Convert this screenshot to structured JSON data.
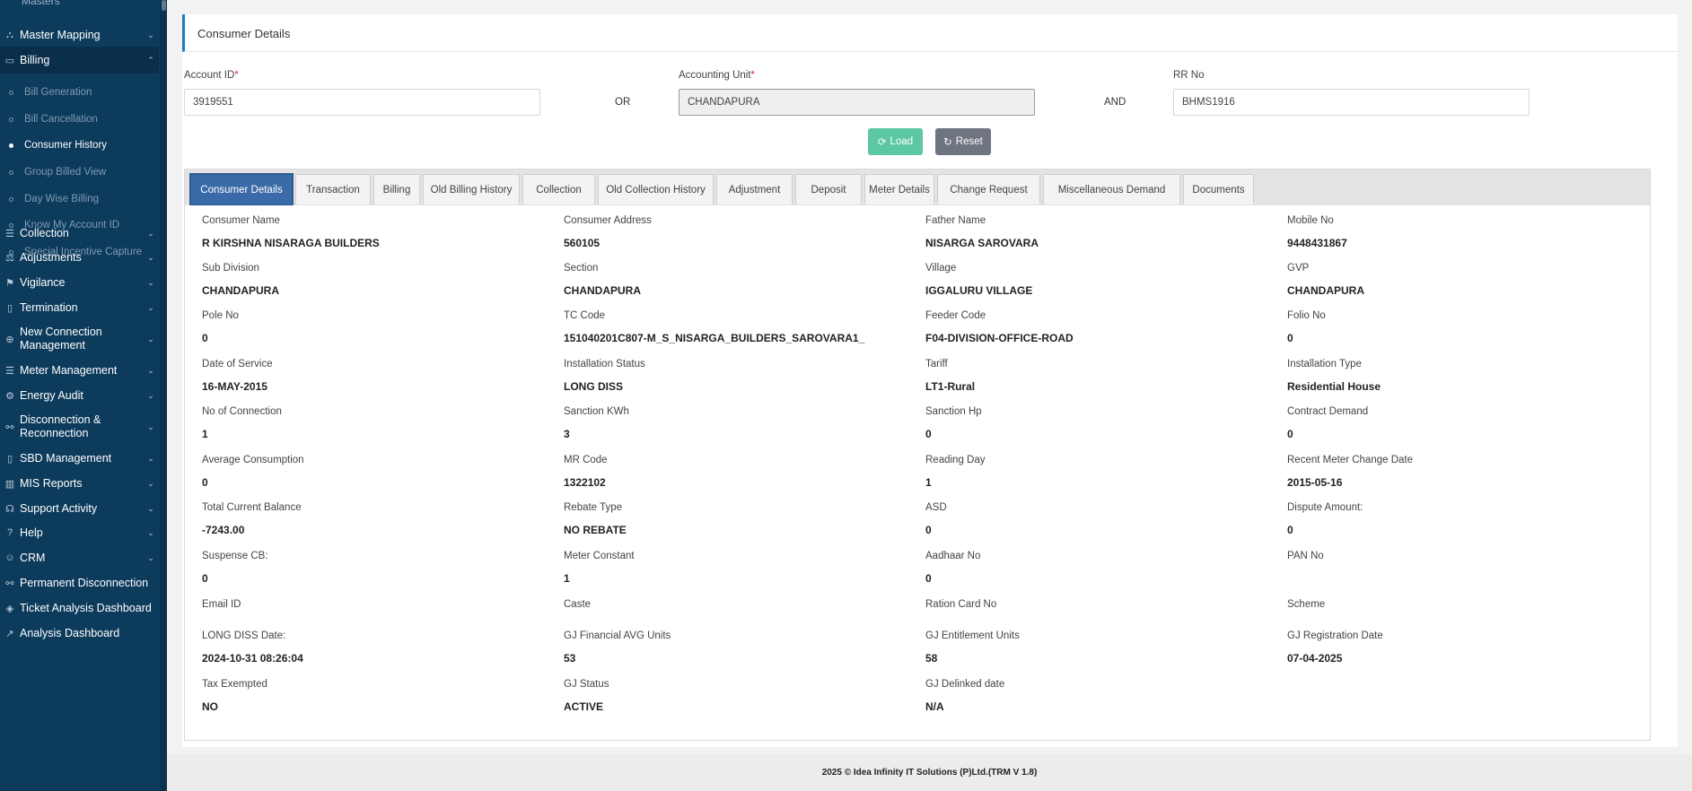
{
  "sidebar": {
    "cut_off_label": "Masters",
    "items": [
      {
        "label": "Master Mapping",
        "icon": "sitemap-icon",
        "glyph": "⛬",
        "chev": "⌄"
      },
      {
        "label": "Billing",
        "icon": "monitor-icon",
        "glyph": "▭",
        "chev": "⌃"
      },
      {
        "label": "Collection",
        "icon": "list-icon",
        "glyph": "☰",
        "chev": "⌄"
      },
      {
        "label": "Adjustments",
        "icon": "balance-icon",
        "glyph": "⚖",
        "chev": "⌄"
      },
      {
        "label": "Vigilance",
        "icon": "vigilance-icon",
        "glyph": "⚑",
        "chev": "⌄"
      },
      {
        "label": "Termination",
        "icon": "trash-icon",
        "glyph": "▯",
        "chev": "⌄"
      },
      {
        "label": "New Connection Management",
        "icon": "plus-circle-icon",
        "glyph": "⊕",
        "chev": "⌄"
      },
      {
        "label": "Meter Management",
        "icon": "list-icon",
        "glyph": "☰",
        "chev": "⌄"
      },
      {
        "label": "Energy Audit",
        "icon": "cogs-icon",
        "glyph": "⚙",
        "chev": "⌄"
      },
      {
        "label": "Disconnection & Reconnection",
        "icon": "link-icon",
        "glyph": "⚯",
        "chev": "⌄"
      },
      {
        "label": "SBD Management",
        "icon": "mobile-icon",
        "glyph": "▯",
        "chev": "⌄"
      },
      {
        "label": "MIS Reports",
        "icon": "bar-chart-icon",
        "glyph": "▥",
        "chev": "⌄"
      },
      {
        "label": "Support Activity",
        "icon": "headset-icon",
        "glyph": "☊",
        "chev": "⌄"
      },
      {
        "label": "Help",
        "icon": "question-icon",
        "glyph": "?",
        "chev": "⌄"
      },
      {
        "label": "CRM",
        "icon": "user-icon",
        "glyph": "☺",
        "chev": "⌄"
      },
      {
        "label": "Permanent Disconnection",
        "icon": "link-icon",
        "glyph": "⚯",
        "chev": ""
      },
      {
        "label": "Ticket Analysis Dashboard",
        "icon": "tag-icon",
        "glyph": "◈",
        "chev": ""
      },
      {
        "label": "Analysis Dashboard",
        "icon": "line-chart-icon",
        "glyph": "↗",
        "chev": ""
      }
    ],
    "billing_sub": [
      "Bill Generation",
      "Bill Cancellation",
      "Consumer History",
      "Group Billed View",
      "Day Wise Billing",
      "Know My Account ID",
      "Special Incentive Capture"
    ],
    "current_sub": "Consumer History"
  },
  "page": {
    "title": "Consumer Details"
  },
  "search": {
    "account_id_label": "Account ID",
    "account_id_value": "3919551",
    "or_label": "OR",
    "accounting_unit_label": "Accounting Unit",
    "accounting_unit_value": "CHANDAPURA",
    "and_label": "AND",
    "rr_no_label": "RR No",
    "rr_no_value": "BHMS1916",
    "required_mark": "*"
  },
  "buttons": {
    "load": "Load",
    "reset": "Reset"
  },
  "tabs": [
    "Consumer Details",
    "Transaction",
    "Billing",
    "Old Billing History",
    "Collection",
    "Old Collection History",
    "Adjustment",
    "Deposit",
    "Meter Details",
    "Change Request",
    "Miscellaneous Demand",
    "Documents"
  ],
  "active_tab": "Consumer Details",
  "details": [
    {
      "label": "Consumer Name",
      "value": "R KIRSHNA NISARAGA BUILDERS"
    },
    {
      "label": "Consumer Address",
      "value": "560105"
    },
    {
      "label": "Father Name",
      "value": "NISARGA SAROVARA"
    },
    {
      "label": "Mobile No",
      "value": "9448431867"
    },
    {
      "label": "Sub Division",
      "value": "CHANDAPURA"
    },
    {
      "label": "Section",
      "value": "CHANDAPURA"
    },
    {
      "label": "Village",
      "value": "IGGALURU VILLAGE"
    },
    {
      "label": "GVP",
      "value": "CHANDAPURA"
    },
    {
      "label": "Pole No",
      "value": "0"
    },
    {
      "label": "TC Code",
      "value": "151040201C807-M_S_NISARGA_BUILDERS_SAROVARA1_"
    },
    {
      "label": "Feeder Code",
      "value": "F04-DIVISION-OFFICE-ROAD"
    },
    {
      "label": "Folio No",
      "value": "0"
    },
    {
      "label": "Date of Service",
      "value": "16-MAY-2015"
    },
    {
      "label": "Installation Status",
      "value": "LONG DISS"
    },
    {
      "label": "Tariff",
      "value": "LT1-Rural"
    },
    {
      "label": "Installation Type",
      "value": "Residential House"
    },
    {
      "label": "No of Connection",
      "value": "1"
    },
    {
      "label": "Sanction KWh",
      "value": "3"
    },
    {
      "label": "Sanction Hp",
      "value": "0"
    },
    {
      "label": "Contract Demand",
      "value": "0"
    },
    {
      "label": "Average Consumption",
      "value": "0"
    },
    {
      "label": "MR Code",
      "value": "1322102"
    },
    {
      "label": "Reading Day",
      "value": "1"
    },
    {
      "label": "Recent Meter Change Date",
      "value": "2015-05-16"
    },
    {
      "label": "Total Current Balance",
      "value": "-7243.00"
    },
    {
      "label": "Rebate Type",
      "value": "NO REBATE"
    },
    {
      "label": "ASD",
      "value": "0"
    },
    {
      "label": "Dispute Amount:",
      "value": "0"
    },
    {
      "label": "Suspense CB:",
      "value": "0"
    },
    {
      "label": "Meter Constant",
      "value": "1"
    },
    {
      "label": "Aadhaar No",
      "value": "0"
    },
    {
      "label": "PAN No",
      "value": ""
    },
    {
      "label": "Email ID",
      "value": ""
    },
    {
      "label": "Caste",
      "value": ""
    },
    {
      "label": "Ration Card No",
      "value": ""
    },
    {
      "label": "Scheme",
      "value": ""
    },
    {
      "label": "LONG DISS Date:",
      "value": "2024-10-31 08:26:04"
    },
    {
      "label": "GJ Financial AVG Units",
      "value": "53"
    },
    {
      "label": "GJ Entitlement Units",
      "value": "58"
    },
    {
      "label": "GJ Registration Date",
      "value": "07-04-2025"
    },
    {
      "label": "Tax Exempted",
      "value": "NO"
    },
    {
      "label": "GJ Status",
      "value": "ACTIVE"
    },
    {
      "label": "GJ Delinked date",
      "value": "N/A"
    }
  ],
  "footer": {
    "text": "2025 © Idea Infinity IT Solutions (P)Ltd.(TRM V 1.8)"
  }
}
